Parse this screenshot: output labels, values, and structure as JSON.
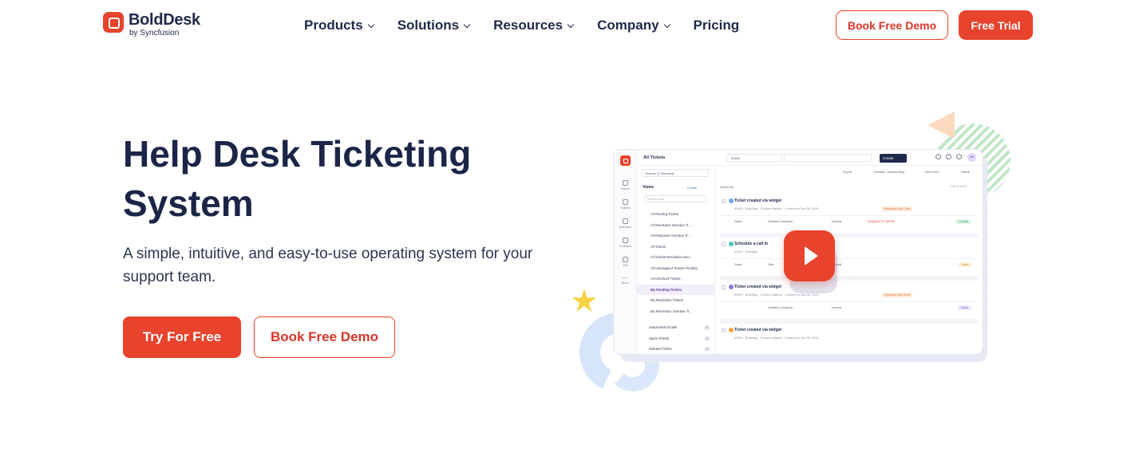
{
  "brand": {
    "name": "BoldDesk",
    "sub": "by Syncfusion",
    "accent": "#e8432d"
  },
  "nav": [
    {
      "label": "Products"
    },
    {
      "label": "Solutions"
    },
    {
      "label": "Resources"
    },
    {
      "label": "Company"
    },
    {
      "label": "Pricing"
    }
  ],
  "header": {
    "demo_label": "Book Free Demo",
    "trial_label": "Free Trial"
  },
  "hero": {
    "title": "Help Desk Ticketing System",
    "subtitle": "A simple, intuitive, and easy-to-use operating system for your support team.",
    "try_label": "Try For Free",
    "demo_label": "Book Free Demo"
  },
  "app": {
    "title": "All Tickets",
    "view_select": "Tickets",
    "create_label": "Create",
    "avatar": "AM",
    "brands": "Brands (3 Selected)",
    "views_label": "Views",
    "views_create": "Create",
    "search_views": "Search view",
    "export": "Export",
    "sort": "Created - Descending",
    "card_view": "Card View",
    "filters": "Filters",
    "select_all": "Select all",
    "pager": "1-20 of 1222",
    "rail": [
      "Home",
      "Tickets",
      "Activities",
      "Contacts",
      "KB",
      "More"
    ],
    "views": [
      "All Pending Tickets",
      "All Resolution Overdue Ti...",
      "All Response Overdue Ti...",
      "All Tickets",
      "All Tickets Resolution Due...",
      "All Unassigned Tickets Pending",
      "All Unsolved Tickets",
      "My Pending Tickets",
      "My Resolution Tickets",
      "My Resolution Overdue Ti..."
    ],
    "bottom": [
      {
        "label": "Suspended Emails",
        "count": "32"
      },
      {
        "label": "Spam Tickets",
        "count": "21"
      },
      {
        "label": "Deleted Tickets",
        "count": "12"
      }
    ],
    "tickets": [
      {
        "title": "Ticket created via widget",
        "meta": "#3209   ·   BoldSign   ·   Charles Mathew   ·   Created by Dec 30, 2020",
        "badge": "Response Due 7 hrs",
        "group": "Sales",
        "agent": "Yolanthe Ivanbook",
        "priority": "Normal",
        "due": "03/Apr/22 07:45 PM",
        "status": "Closed"
      },
      {
        "title": "Schedule a call fo",
        "meta": "#3209   ·   BoldSign",
        "badge": "",
        "group": "Sales",
        "agent": "Yola",
        "priority": "Normal",
        "due": "",
        "status": "New"
      },
      {
        "title": "Ticket created via widget",
        "meta": "#3209   ·   BoldSign   ·   Charles Mathew   ·   Created by Dec 30, 2020",
        "badge": "Response Due 6 hrs",
        "group": "",
        "agent": "Yolanthe Ivanbook",
        "priority": "Normal",
        "due": "",
        "status": "Open"
      },
      {
        "title": "Ticket created via widget",
        "meta": "#3209   ·   BoldSign   ·   Charles Mathew   ·   Created by Dec 30, 2020",
        "badge": "",
        "group": "",
        "agent": "",
        "priority": "",
        "due": "",
        "status": ""
      }
    ]
  }
}
